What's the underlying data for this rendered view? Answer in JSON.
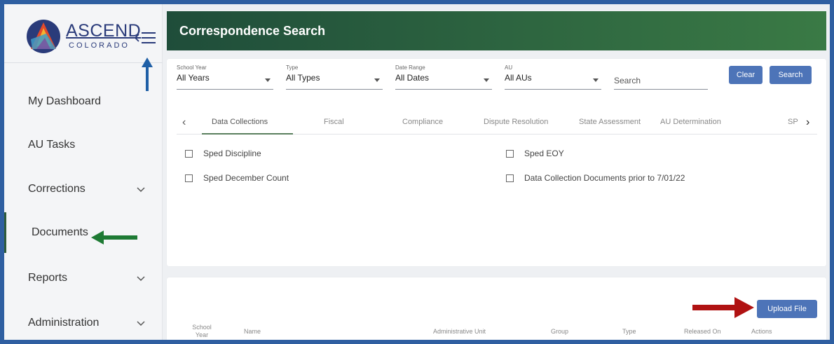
{
  "brand": {
    "name": "ASCEND",
    "subtitle": "COLORADO"
  },
  "sidebar": {
    "items": [
      {
        "label": "My Dashboard",
        "expandable": false
      },
      {
        "label": "AU Tasks",
        "expandable": false
      },
      {
        "label": "Corrections",
        "expandable": true
      },
      {
        "label": "Documents",
        "expandable": false,
        "active": true
      },
      {
        "label": "Reports",
        "expandable": true
      },
      {
        "label": "Administration",
        "expandable": true
      }
    ]
  },
  "header": {
    "title": "Correspondence Search"
  },
  "filters": {
    "school_year": {
      "label": "School Year",
      "value": "All Years"
    },
    "type": {
      "label": "Type",
      "value": "All Types"
    },
    "date_range": {
      "label": "Date Range",
      "value": "All Dates"
    },
    "au": {
      "label": "AU",
      "value": "All AUs"
    },
    "search_placeholder": "Search",
    "clear_label": "Clear",
    "search_label": "Search"
  },
  "tabs": [
    {
      "label": "Data Collections",
      "active": true
    },
    {
      "label": "Fiscal"
    },
    {
      "label": "Compliance"
    },
    {
      "label": "Dispute Resolution"
    },
    {
      "label": "State Assessment"
    },
    {
      "label": "AU Determination"
    },
    {
      "label": "SP"
    }
  ],
  "checkboxes": [
    {
      "label": "Sped Discipline",
      "checked": false
    },
    {
      "label": "Sped EOY",
      "checked": false
    },
    {
      "label": "Sped December Count",
      "checked": false
    },
    {
      "label": "Data Collection Documents prior to 7/01/22",
      "checked": false
    }
  ],
  "results": {
    "upload_label": "Upload File",
    "columns": [
      "School Year",
      "Name",
      "Administrative Unit",
      "Group",
      "Type",
      "Released On",
      "Actions"
    ]
  },
  "colors": {
    "header_start": "#1f4d3a",
    "header_end": "#3a7a45",
    "button": "#4d74b8",
    "frame": "#2f5fa1",
    "annotation_blue": "#1f5fa6",
    "annotation_green": "#1e7a34",
    "annotation_red": "#b01212"
  }
}
